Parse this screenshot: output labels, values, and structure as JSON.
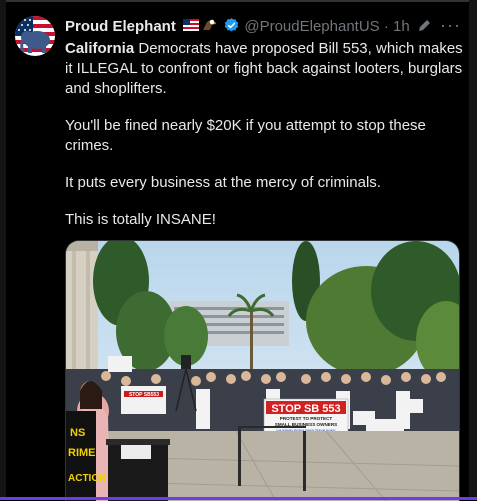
{
  "tweet": {
    "display_name": "Proud Elephant",
    "handle": "@ProudElephantUS",
    "separator": "·",
    "time": "1h",
    "more_label": "···",
    "text": {
      "line1_bold": "California",
      "line1_rest": " Democrats have proposed Bill 553, which makes it ILLEGAL to confront or fight back against looters, burglars and shoplifters.",
      "p2": "You'll be fined nearly $20K if you attempt to stop these crimes.",
      "p3": "It puts every business at the mercy of criminals.",
      "p4": "This is totally INSANE!"
    }
  },
  "media": {
    "sign_main": "STOP SB 553",
    "sign_sub1": "PROTEST TO PROTECT",
    "sign_sub2": "SMALL BUSINESS OWNERS",
    "sign_sub3": "Los Angeles  Ventura County  Orange County",
    "side_banner": "NS\nRIME\nACTION",
    "small_sign1": "STOP SB553"
  },
  "colors": {
    "accent_verified": "#1d9bf0",
    "text_primary": "#e7e9ea",
    "text_secondary": "#71767b",
    "sign_red": "#d32020"
  }
}
